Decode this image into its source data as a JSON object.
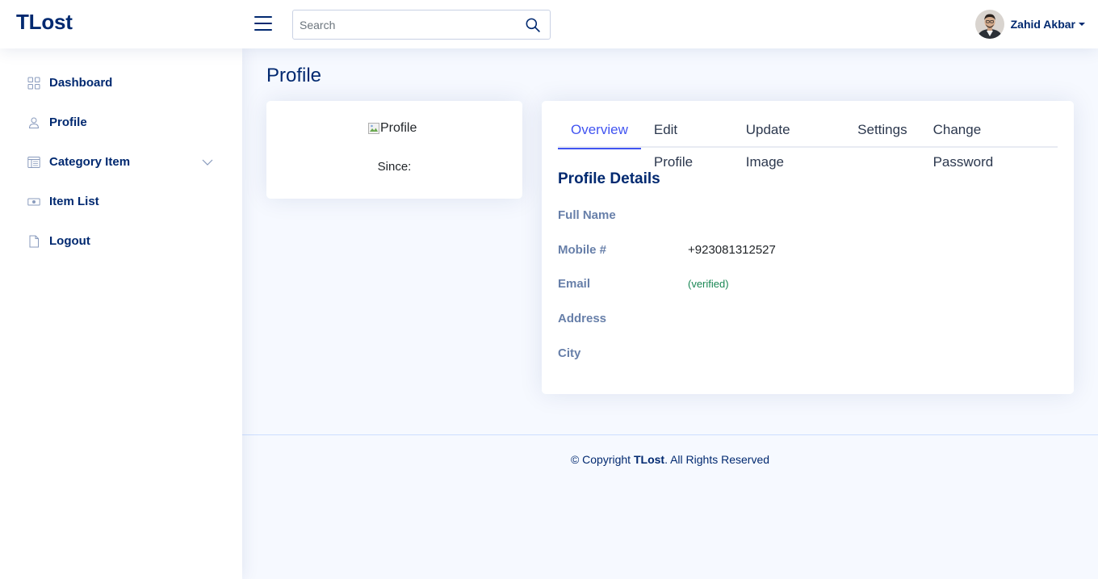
{
  "header": {
    "logo": "TLost",
    "search_placeholder": "Search",
    "user_name": "Zahid Akbar"
  },
  "sidebar": {
    "items": [
      {
        "label": "Dashboard",
        "icon": "grid-icon"
      },
      {
        "label": "Profile",
        "icon": "person-icon"
      },
      {
        "label": "Category Item",
        "icon": "layout-text-icon",
        "has_submenu": true
      },
      {
        "label": "Item List",
        "icon": "cash-icon"
      },
      {
        "label": "Logout",
        "icon": "file-icon"
      }
    ]
  },
  "main": {
    "page_title": "Profile",
    "profile_card": {
      "image_alt": "Profile",
      "since_label": "Since:"
    },
    "tabs": [
      "Overview",
      "Edit Profile",
      "Update Image",
      "Settings",
      "Change Password"
    ],
    "active_tab": "Overview",
    "details": {
      "title": "Profile Details",
      "rows": [
        {
          "label": "Full Name",
          "value": ""
        },
        {
          "label": "Mobile #",
          "value": "+923081312527"
        },
        {
          "label": "Email",
          "value": "(verified)"
        },
        {
          "label": "Address",
          "value": ""
        },
        {
          "label": "City",
          "value": ""
        }
      ]
    }
  },
  "footer": {
    "prefix": "© Copyright ",
    "brand": "TLost",
    "suffix": ". All Rights Reserved"
  },
  "colors": {
    "primary": "#012970",
    "accent": "#4154f1",
    "verified": "#198754",
    "background": "#f6f9ff"
  }
}
